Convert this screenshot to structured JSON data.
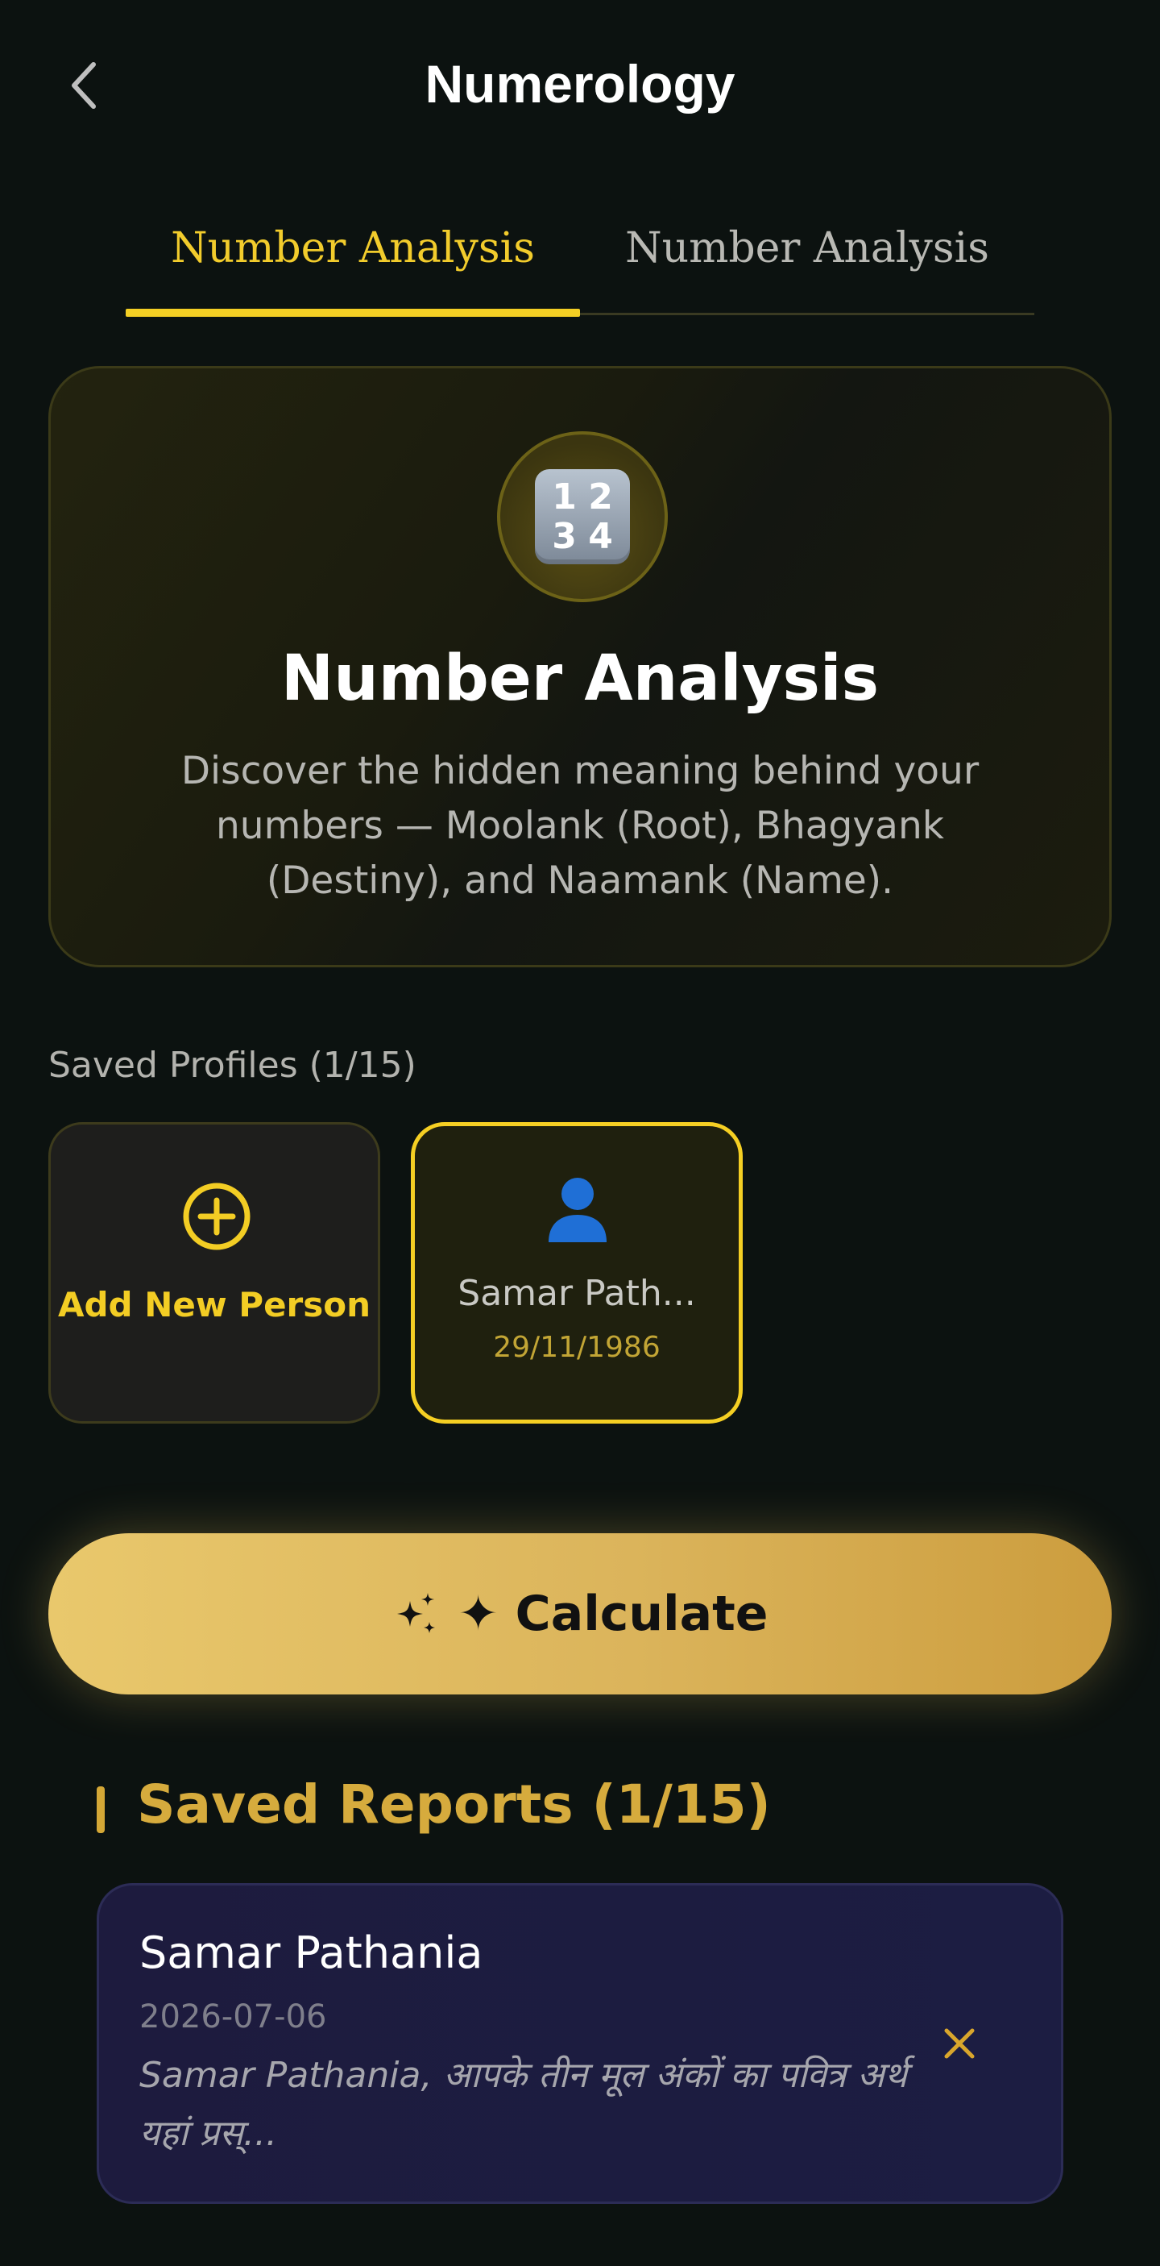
{
  "header": {
    "title": "Numerology",
    "back_icon": "chevron-left-icon"
  },
  "tabs": [
    {
      "label": "Number Analysis",
      "active": true
    },
    {
      "label": "Number Analysis",
      "active": false
    }
  ],
  "hero": {
    "icon": "input-numbers-icon",
    "icon_digits": [
      "1",
      "2",
      "3",
      "4"
    ],
    "title": "Number Analysis",
    "description": "Discover the hidden meaning behind your numbers — Moolank (Root), Bhagyank (Destiny), and Naamank (Name)."
  },
  "profiles": {
    "label": "Saved Profiles (1/15)",
    "add_label": "Add New Person",
    "items": [
      {
        "name": "Samar Path...",
        "date": "29/11/1986",
        "selected": true
      }
    ]
  },
  "calculate": {
    "label": "✦ Calculate"
  },
  "reports": {
    "title": "Saved Reports (1/15)",
    "items": [
      {
        "name": "Samar Pathania",
        "date": "2026-07-06",
        "snippet": "Samar Pathania, आपके तीन मूल अंकों का पवित्र अर्थ यहां प्रस्..."
      }
    ]
  },
  "colors": {
    "background": "#0c1210",
    "accent_yellow": "#f4cf24",
    "gold": "#d6ab3d",
    "report_card": "#1d1b3e",
    "person_icon": "#1f6fd6"
  }
}
